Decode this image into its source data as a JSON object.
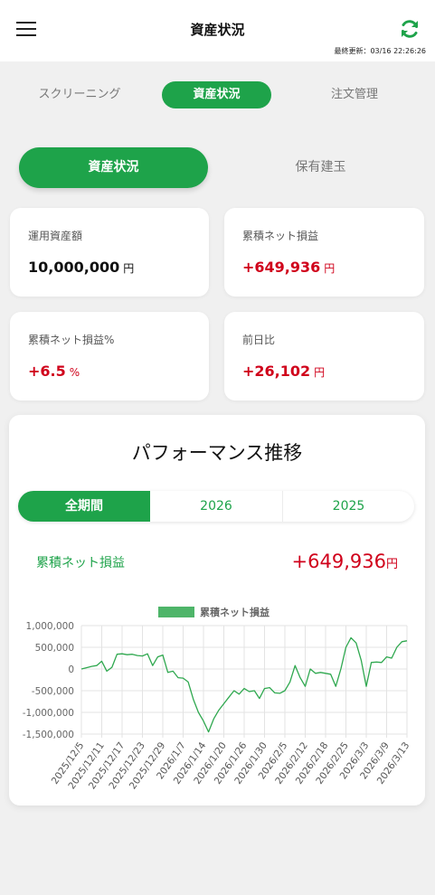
{
  "header": {
    "title": "資産状況",
    "updated": "最終更新：03/16 22:26:26",
    "accent_color": "#1ea34a"
  },
  "nav": {
    "tabs": [
      {
        "label": "スクリーニング",
        "active": false
      },
      {
        "label": "資産状況",
        "active": true
      },
      {
        "label": "注文管理",
        "active": false
      }
    ]
  },
  "segment": {
    "tabs": [
      {
        "label": "資産状況",
        "active": true
      },
      {
        "label": "保有建玉",
        "active": false
      }
    ]
  },
  "cards": {
    "assets": {
      "label": "運用資産額",
      "value": "10,000,000",
      "unit": "円"
    },
    "cum_pnl": {
      "label": "累積ネット損益",
      "value": "+649,936",
      "unit": "円"
    },
    "cum_pnl_pct": {
      "label": "累積ネット損益%",
      "value": "+6.5",
      "unit": "%"
    },
    "day_change": {
      "label": "前日比",
      "value": "+26,102",
      "unit": "円"
    }
  },
  "performance": {
    "title": "パフォーマンス推移",
    "periods": [
      {
        "label": "全期間",
        "active": true
      },
      {
        "label": "2026",
        "active": false
      },
      {
        "label": "2025",
        "active": false
      }
    ],
    "metric_label": "累積ネット損益",
    "metric_value": "+649,936",
    "metric_unit": "円"
  },
  "chart_data": {
    "type": "line",
    "legend": "累積ネット損益",
    "legend_position": "top",
    "grid": true,
    "line_color": "#2fa84f",
    "ylim": [
      -1500000,
      1000000
    ],
    "yticks": [
      "1,000,000",
      "500,000",
      "0",
      "-500,000",
      "-1,000,000",
      "-1,500,000"
    ],
    "ytick_values": [
      1000000,
      500000,
      0,
      -500000,
      -1000000,
      -1500000
    ],
    "xticks": [
      "2025/12/5",
      "2025/12/11",
      "2025/12/17",
      "2025/12/23",
      "2025/12/29",
      "2026/1/7",
      "2026/1/14",
      "2026/1/20",
      "2026/1/26",
      "2026/1/30",
      "2026/2/5",
      "2026/2/12",
      "2026/2/18",
      "2026/2/25",
      "2026/3/3",
      "2026/3/9",
      "2026/3/13"
    ],
    "series": [
      {
        "name": "累積ネット損益",
        "values": [
          0,
          30000,
          60000,
          80000,
          180000,
          -50000,
          40000,
          340000,
          350000,
          330000,
          340000,
          310000,
          300000,
          350000,
          80000,
          280000,
          320000,
          -80000,
          -50000,
          -200000,
          -210000,
          -300000,
          -700000,
          -1000000,
          -1200000,
          -1450000,
          -1150000,
          -950000,
          -800000,
          -650000,
          -500000,
          -580000,
          -450000,
          -520000,
          -500000,
          -680000,
          -450000,
          -430000,
          -550000,
          -560000,
          -500000,
          -300000,
          80000,
          -200000,
          -400000,
          0,
          -100000,
          -80000,
          -100000,
          -120000,
          -400000,
          0,
          500000,
          720000,
          600000,
          200000,
          -400000,
          150000,
          160000,
          150000,
          280000,
          250000,
          500000,
          630000,
          650000
        ]
      }
    ]
  }
}
